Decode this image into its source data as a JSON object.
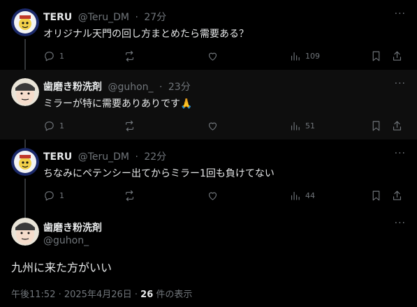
{
  "posts": [
    {
      "author": "TERU",
      "handle": "@Teru_DM",
      "time": "27分",
      "text": "オリジナル天門の回し方まとめたら需要ある？",
      "reply_count": "1",
      "views": "109",
      "avatar_icon": "teru-avatar"
    },
    {
      "author": "歯磨き粉洗剤",
      "handle": "@guhon_",
      "time": "23分",
      "text": "ミラーが特に需要ありありです🙏",
      "reply_count": "1",
      "views": "51",
      "avatar_icon": "guhon-avatar"
    },
    {
      "author": "TERU",
      "handle": "@Teru_DM",
      "time": "22分",
      "text": "ちなみにペテンシー出てからミラー1回も負けてない",
      "reply_count": "1",
      "views": "44",
      "avatar_icon": "teru-avatar"
    }
  ],
  "main_post": {
    "author": "歯磨き粉洗剤",
    "handle": "@guhon_",
    "text": "九州に来た方がいい",
    "timestamp": "午後11:52 · 2025年4月26日 · ",
    "views_count": "26",
    "views_label": " 件の表示"
  },
  "more_label": "···",
  "colors": {
    "background": "#000000",
    "text": "#e7e9ea",
    "muted": "#71767b",
    "highlight_row": "#0e0e0e"
  }
}
